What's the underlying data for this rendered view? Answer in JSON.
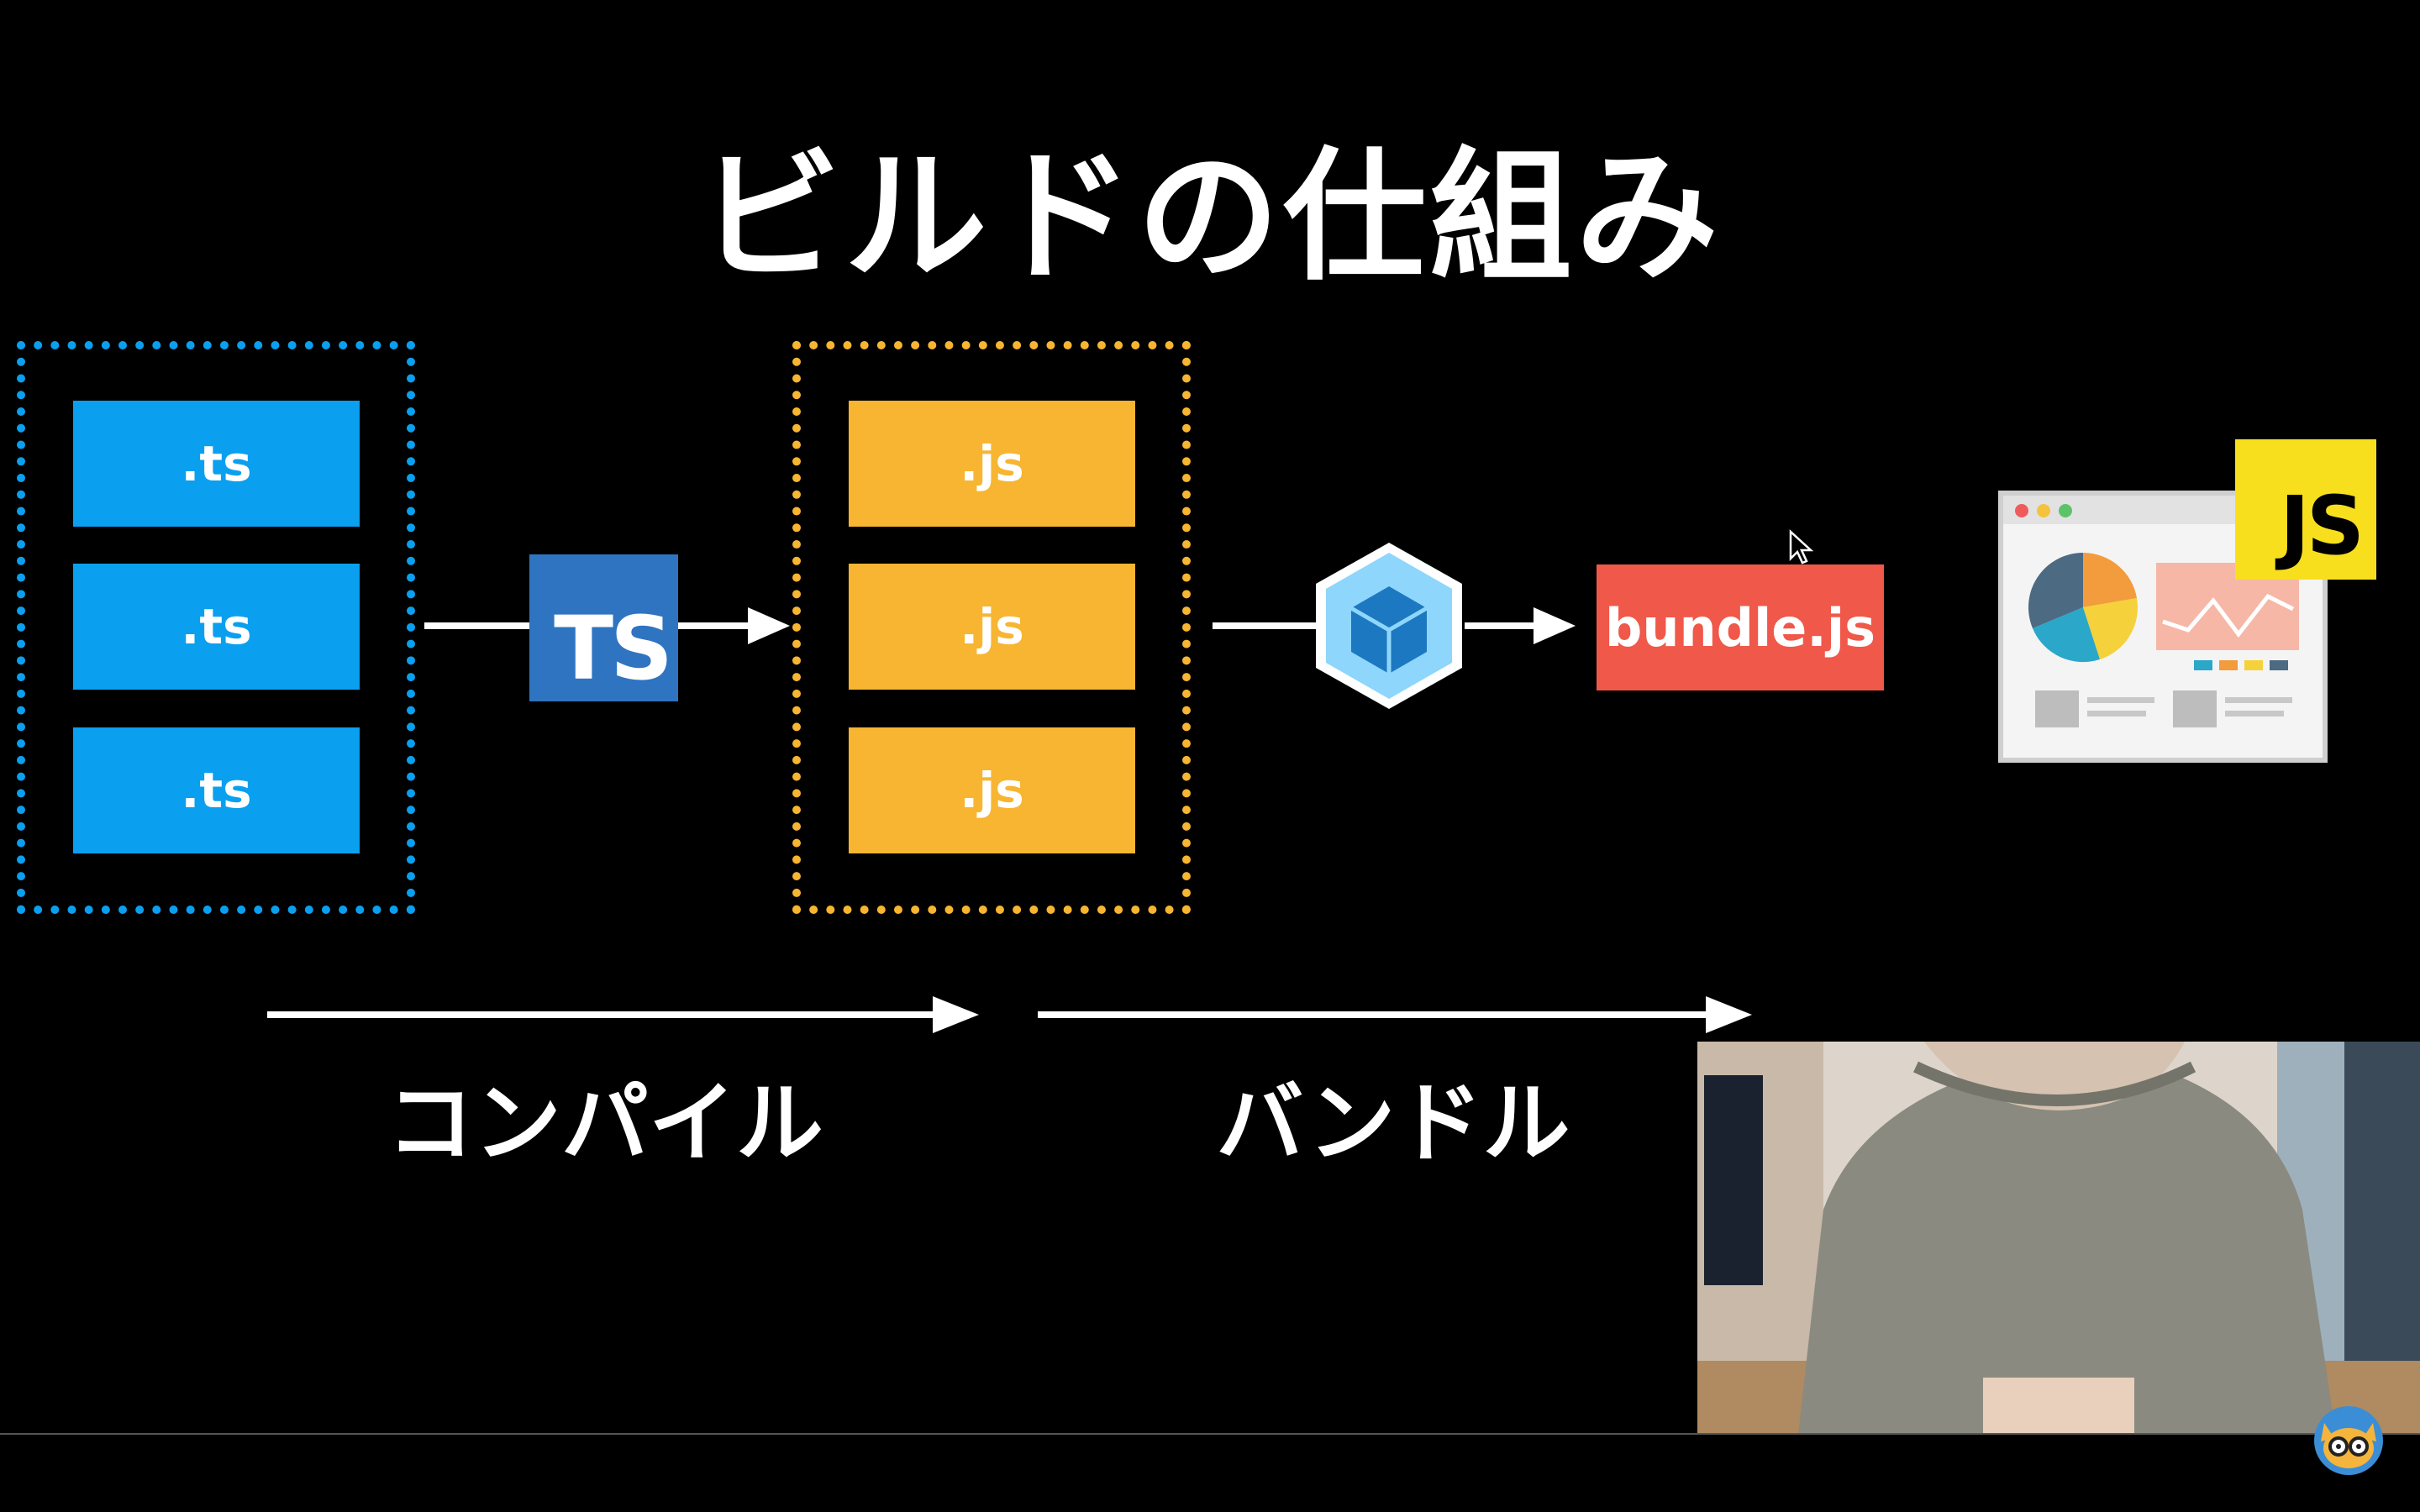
{
  "slide": {
    "title": "ビルドの仕組み",
    "ts_files": [
      ".ts",
      ".ts",
      ".ts"
    ],
    "js_files": [
      ".js",
      ".js",
      ".js"
    ],
    "ts_logo": "TS",
    "bundle": "bundle.js",
    "js_badge": "JS",
    "steps": [
      "コンパイル",
      "バンドル"
    ]
  },
  "icons": {
    "compiler": "typescript-logo-icon",
    "bundler": "webpack-cube-icon",
    "output": "browser-window-icon",
    "cursor": "mouse-cursor-icon",
    "channel": "channel-mascot-icon"
  },
  "colors": {
    "ts_blue": "#0aa0ef",
    "js_yellow": "#f7b531",
    "bundle_red": "#f0584a",
    "ts_logo_blue": "#2f74c0",
    "js_badge_yellow": "#f7df1e"
  }
}
